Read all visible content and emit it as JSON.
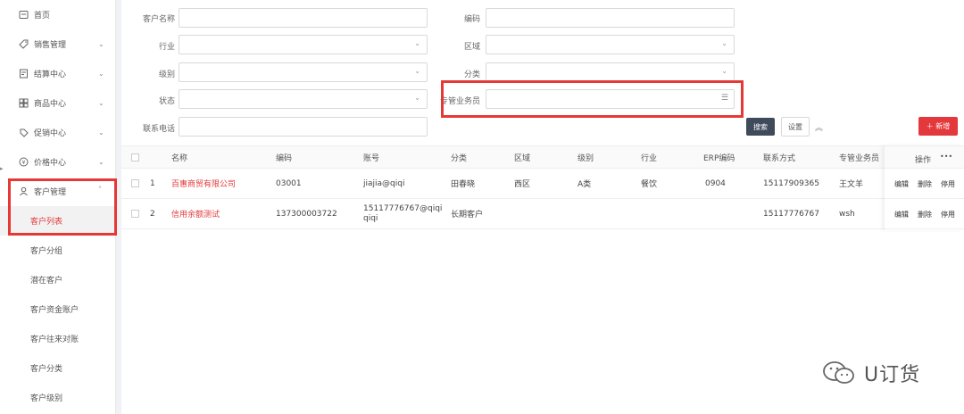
{
  "sidebar": {
    "items": [
      {
        "label": "首页",
        "icon": "home-icon",
        "has_chevron": false
      },
      {
        "label": "销售管理",
        "icon": "tag-icon",
        "has_chevron": true
      },
      {
        "label": "结算中心",
        "icon": "receipt-icon",
        "has_chevron": true
      },
      {
        "label": "商品中心",
        "icon": "grid-icon",
        "has_chevron": true
      },
      {
        "label": "促销中心",
        "icon": "promo-icon",
        "has_chevron": true
      },
      {
        "label": "价格中心",
        "icon": "price-icon",
        "has_chevron": true
      },
      {
        "label": "客户管理",
        "icon": "customer-icon",
        "has_chevron": true
      }
    ],
    "customer_subitems": [
      "客户列表",
      "客户分组",
      "潜在客户",
      "客户资金账户",
      "客户往来对账",
      "客户分类",
      "客户级别"
    ],
    "active_subitem": "客户列表"
  },
  "filters": {
    "customer_name": "客户名称",
    "code": "编码",
    "industry": "行业",
    "region": "区域",
    "level": "级别",
    "category": "分类",
    "status": "状态",
    "salesperson": "专管业务员",
    "phone": "联系电话"
  },
  "buttons": {
    "search": "搜索",
    "settings": "设置",
    "add": "＋ 新增"
  },
  "table": {
    "columns": [
      "名称",
      "编码",
      "账号",
      "分类",
      "区域",
      "级别",
      "行业",
      "ERP编码",
      "联系方式",
      "专管业务员",
      "操作"
    ],
    "more": "•••",
    "rows": [
      {
        "index": "1",
        "name": "百惠商贸有限公司",
        "code": "03001",
        "account": "jiajia@qiqi",
        "account2": "",
        "category": "田春晓",
        "region": "西区",
        "level": "A类",
        "industry": "餐饮",
        "erp": "0904",
        "contact": "15117909365",
        "salesperson": "王文羊",
        "ops": [
          "编辑",
          "删除",
          "停用"
        ]
      },
      {
        "index": "2",
        "name": "信用余额测试",
        "code": "137300003722",
        "account": "15117776767@qiqi",
        "account2": "qiqi",
        "category": "长期客户",
        "region": "",
        "level": "",
        "industry": "",
        "erp": "",
        "contact": "15117776767",
        "salesperson": "wsh",
        "ops": [
          "编辑",
          "删除",
          "停用"
        ]
      }
    ]
  },
  "watermark": {
    "text": "U订货"
  },
  "colors": {
    "accent": "#e4393c",
    "highlight": "#e53935",
    "search_button": "#3f4a5a"
  }
}
